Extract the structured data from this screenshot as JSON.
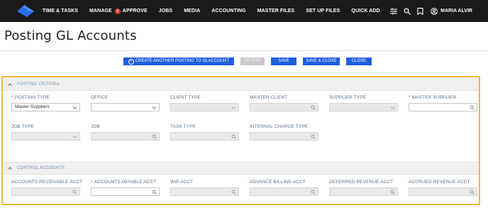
{
  "nav": {
    "items": [
      {
        "label": "TIME & TASKS"
      },
      {
        "label": "MANAGE"
      },
      {
        "label": "APPROVE"
      },
      {
        "label": "JOBS"
      },
      {
        "label": "MEDIA"
      },
      {
        "label": "ACCOUNTING"
      },
      {
        "label": "MASTER FILES"
      },
      {
        "label": "SET UP FILES"
      },
      {
        "label": "QUICK ADD"
      }
    ],
    "badge_count": "1",
    "user_name": "MARIA ALVIR",
    "icons": [
      "filter-sliders-icon",
      "search-icon",
      "bookmark-icon",
      "user-icon"
    ]
  },
  "page": {
    "title": "Posting GL Accounts"
  },
  "actions": {
    "create": "CREATE ANOTHER POSTING TO GLACCOUNT",
    "delete": "DELETE",
    "save": "SAVE",
    "save_close": "SAVE & CLOSE",
    "close": "CLOSE"
  },
  "colors": {
    "nav_bg": "#1a1a1a",
    "accent": "#1f5fe0",
    "highlight": "#f2b632",
    "required": "#d43a2a",
    "badge": "#d63b2a"
  },
  "posting_criteria": {
    "header": "POSTING CRITERIA",
    "fields": {
      "posting_type": {
        "label": "POSTING TYPE",
        "value": "Master Suppliers"
      },
      "office": {
        "label": "OFFICE"
      },
      "client_type": {
        "label": "CLIENT TYPE"
      },
      "master_client": {
        "label": "MASTER CLIENT"
      },
      "supplier_type": {
        "label": "SUPPLIER TYPE"
      },
      "master_supplier": {
        "label": "MASTER SUPPLIER"
      },
      "job_type": {
        "label": "JOB TYPE"
      },
      "job": {
        "label": "JOB"
      },
      "task_type": {
        "label": "TASK TYPE"
      },
      "internal_charge_type": {
        "label": "INTERNAL CHARGE TYPE"
      }
    }
  },
  "control_accounts": {
    "header": "CONTROL ACCOUNTS",
    "fields": {
      "accounts_receivable": {
        "label": "ACCOUNTS RECEIVABLE ACCT"
      },
      "accounts_payable": {
        "label": "ACCOUNTS PAYABLE ACCT"
      },
      "wip": {
        "label": "WIP ACCT"
      },
      "advance_billing": {
        "label": "ADVANCE BILLING ACCT"
      },
      "deferred_revenue": {
        "label": "DEFERRED REVENUE ACCT"
      },
      "accrued_revenue": {
        "label": "ACCRUED REVENUE ACCT"
      }
    }
  }
}
